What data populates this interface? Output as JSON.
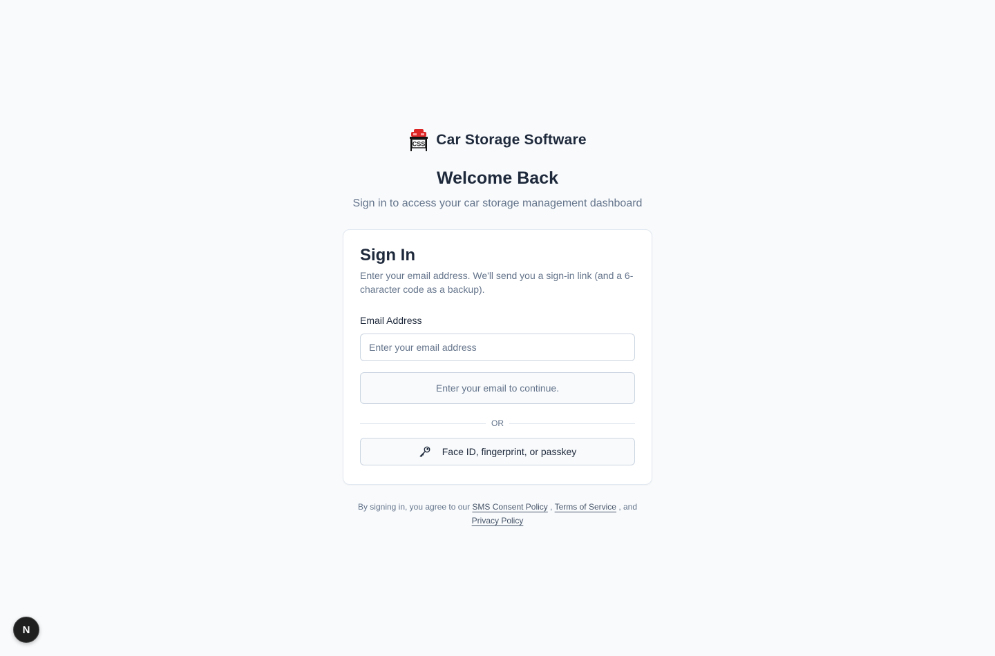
{
  "brand": {
    "logo_icon": "car-storage-logo-icon",
    "logo_text": "CSS",
    "name": "Car Storage Software"
  },
  "heading": {
    "title": "Welcome Back",
    "subtitle": "Sign in to access your car storage management dashboard"
  },
  "signin_card": {
    "title": "Sign In",
    "description": "Enter your email address. We'll send you a sign-in link (and a 6-character code as a backup).",
    "email_label": "Email Address",
    "email_placeholder": "Enter your email address",
    "email_value": "",
    "continue_label": "Enter your email to continue.",
    "divider_text": "OR",
    "passkey_icon": "key-icon",
    "passkey_label": "Face ID, fingerprint, or passkey"
  },
  "legal": {
    "prefix": "By signing in, you agree to our",
    "sms_link": "SMS Consent Policy",
    "comma": ",",
    "terms_link": "Terms of Service",
    "and_text": ", and",
    "privacy_link": "Privacy Policy"
  },
  "dev_badge": {
    "icon": "nextjs-icon",
    "label": "N"
  },
  "colors": {
    "background": "#f8fafc",
    "text_primary": "#1e293b",
    "text_muted": "#64748b",
    "border": "#cbd5e1",
    "logo_red": "#dc2626"
  }
}
